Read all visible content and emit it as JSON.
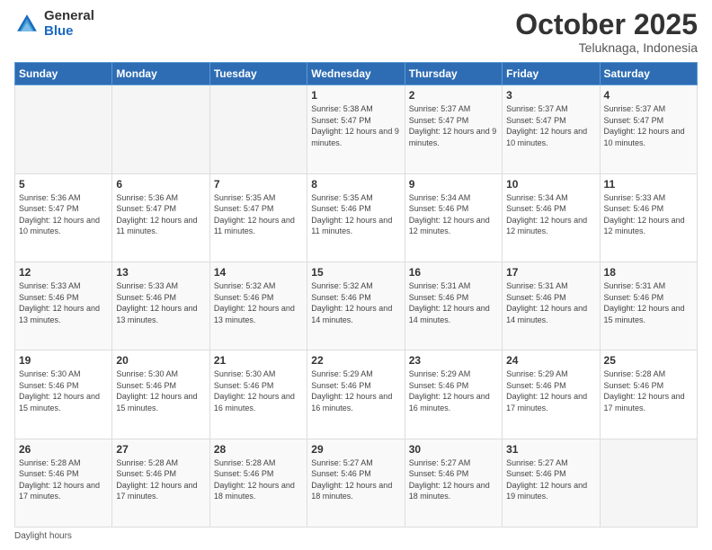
{
  "header": {
    "logo_general": "General",
    "logo_blue": "Blue",
    "month_title": "October 2025",
    "subtitle": "Teluknaga, Indonesia"
  },
  "weekdays": [
    "Sunday",
    "Monday",
    "Tuesday",
    "Wednesday",
    "Thursday",
    "Friday",
    "Saturday"
  ],
  "legend": {
    "daylight_label": "Daylight hours"
  },
  "weeks": [
    [
      {
        "day": "",
        "sunrise": "",
        "sunset": "",
        "daylight": "",
        "empty": true
      },
      {
        "day": "",
        "sunrise": "",
        "sunset": "",
        "daylight": "",
        "empty": true
      },
      {
        "day": "",
        "sunrise": "",
        "sunset": "",
        "daylight": "",
        "empty": true
      },
      {
        "day": "1",
        "sunrise": "Sunrise: 5:38 AM",
        "sunset": "Sunset: 5:47 PM",
        "daylight": "Daylight: 12 hours and 9 minutes.",
        "empty": false
      },
      {
        "day": "2",
        "sunrise": "Sunrise: 5:37 AM",
        "sunset": "Sunset: 5:47 PM",
        "daylight": "Daylight: 12 hours and 9 minutes.",
        "empty": false
      },
      {
        "day": "3",
        "sunrise": "Sunrise: 5:37 AM",
        "sunset": "Sunset: 5:47 PM",
        "daylight": "Daylight: 12 hours and 10 minutes.",
        "empty": false
      },
      {
        "day": "4",
        "sunrise": "Sunrise: 5:37 AM",
        "sunset": "Sunset: 5:47 PM",
        "daylight": "Daylight: 12 hours and 10 minutes.",
        "empty": false
      }
    ],
    [
      {
        "day": "5",
        "sunrise": "Sunrise: 5:36 AM",
        "sunset": "Sunset: 5:47 PM",
        "daylight": "Daylight: 12 hours and 10 minutes.",
        "empty": false
      },
      {
        "day": "6",
        "sunrise": "Sunrise: 5:36 AM",
        "sunset": "Sunset: 5:47 PM",
        "daylight": "Daylight: 12 hours and 11 minutes.",
        "empty": false
      },
      {
        "day": "7",
        "sunrise": "Sunrise: 5:35 AM",
        "sunset": "Sunset: 5:47 PM",
        "daylight": "Daylight: 12 hours and 11 minutes.",
        "empty": false
      },
      {
        "day": "8",
        "sunrise": "Sunrise: 5:35 AM",
        "sunset": "Sunset: 5:46 PM",
        "daylight": "Daylight: 12 hours and 11 minutes.",
        "empty": false
      },
      {
        "day": "9",
        "sunrise": "Sunrise: 5:34 AM",
        "sunset": "Sunset: 5:46 PM",
        "daylight": "Daylight: 12 hours and 12 minutes.",
        "empty": false
      },
      {
        "day": "10",
        "sunrise": "Sunrise: 5:34 AM",
        "sunset": "Sunset: 5:46 PM",
        "daylight": "Daylight: 12 hours and 12 minutes.",
        "empty": false
      },
      {
        "day": "11",
        "sunrise": "Sunrise: 5:33 AM",
        "sunset": "Sunset: 5:46 PM",
        "daylight": "Daylight: 12 hours and 12 minutes.",
        "empty": false
      }
    ],
    [
      {
        "day": "12",
        "sunrise": "Sunrise: 5:33 AM",
        "sunset": "Sunset: 5:46 PM",
        "daylight": "Daylight: 12 hours and 13 minutes.",
        "empty": false
      },
      {
        "day": "13",
        "sunrise": "Sunrise: 5:33 AM",
        "sunset": "Sunset: 5:46 PM",
        "daylight": "Daylight: 12 hours and 13 minutes.",
        "empty": false
      },
      {
        "day": "14",
        "sunrise": "Sunrise: 5:32 AM",
        "sunset": "Sunset: 5:46 PM",
        "daylight": "Daylight: 12 hours and 13 minutes.",
        "empty": false
      },
      {
        "day": "15",
        "sunrise": "Sunrise: 5:32 AM",
        "sunset": "Sunset: 5:46 PM",
        "daylight": "Daylight: 12 hours and 14 minutes.",
        "empty": false
      },
      {
        "day": "16",
        "sunrise": "Sunrise: 5:31 AM",
        "sunset": "Sunset: 5:46 PM",
        "daylight": "Daylight: 12 hours and 14 minutes.",
        "empty": false
      },
      {
        "day": "17",
        "sunrise": "Sunrise: 5:31 AM",
        "sunset": "Sunset: 5:46 PM",
        "daylight": "Daylight: 12 hours and 14 minutes.",
        "empty": false
      },
      {
        "day": "18",
        "sunrise": "Sunrise: 5:31 AM",
        "sunset": "Sunset: 5:46 PM",
        "daylight": "Daylight: 12 hours and 15 minutes.",
        "empty": false
      }
    ],
    [
      {
        "day": "19",
        "sunrise": "Sunrise: 5:30 AM",
        "sunset": "Sunset: 5:46 PM",
        "daylight": "Daylight: 12 hours and 15 minutes.",
        "empty": false
      },
      {
        "day": "20",
        "sunrise": "Sunrise: 5:30 AM",
        "sunset": "Sunset: 5:46 PM",
        "daylight": "Daylight: 12 hours and 15 minutes.",
        "empty": false
      },
      {
        "day": "21",
        "sunrise": "Sunrise: 5:30 AM",
        "sunset": "Sunset: 5:46 PM",
        "daylight": "Daylight: 12 hours and 16 minutes.",
        "empty": false
      },
      {
        "day": "22",
        "sunrise": "Sunrise: 5:29 AM",
        "sunset": "Sunset: 5:46 PM",
        "daylight": "Daylight: 12 hours and 16 minutes.",
        "empty": false
      },
      {
        "day": "23",
        "sunrise": "Sunrise: 5:29 AM",
        "sunset": "Sunset: 5:46 PM",
        "daylight": "Daylight: 12 hours and 16 minutes.",
        "empty": false
      },
      {
        "day": "24",
        "sunrise": "Sunrise: 5:29 AM",
        "sunset": "Sunset: 5:46 PM",
        "daylight": "Daylight: 12 hours and 17 minutes.",
        "empty": false
      },
      {
        "day": "25",
        "sunrise": "Sunrise: 5:28 AM",
        "sunset": "Sunset: 5:46 PM",
        "daylight": "Daylight: 12 hours and 17 minutes.",
        "empty": false
      }
    ],
    [
      {
        "day": "26",
        "sunrise": "Sunrise: 5:28 AM",
        "sunset": "Sunset: 5:46 PM",
        "daylight": "Daylight: 12 hours and 17 minutes.",
        "empty": false
      },
      {
        "day": "27",
        "sunrise": "Sunrise: 5:28 AM",
        "sunset": "Sunset: 5:46 PM",
        "daylight": "Daylight: 12 hours and 17 minutes.",
        "empty": false
      },
      {
        "day": "28",
        "sunrise": "Sunrise: 5:28 AM",
        "sunset": "Sunset: 5:46 PM",
        "daylight": "Daylight: 12 hours and 18 minutes.",
        "empty": false
      },
      {
        "day": "29",
        "sunrise": "Sunrise: 5:27 AM",
        "sunset": "Sunset: 5:46 PM",
        "daylight": "Daylight: 12 hours and 18 minutes.",
        "empty": false
      },
      {
        "day": "30",
        "sunrise": "Sunrise: 5:27 AM",
        "sunset": "Sunset: 5:46 PM",
        "daylight": "Daylight: 12 hours and 18 minutes.",
        "empty": false
      },
      {
        "day": "31",
        "sunrise": "Sunrise: 5:27 AM",
        "sunset": "Sunset: 5:46 PM",
        "daylight": "Daylight: 12 hours and 19 minutes.",
        "empty": false
      },
      {
        "day": "",
        "sunrise": "",
        "sunset": "",
        "daylight": "",
        "empty": true
      }
    ]
  ]
}
